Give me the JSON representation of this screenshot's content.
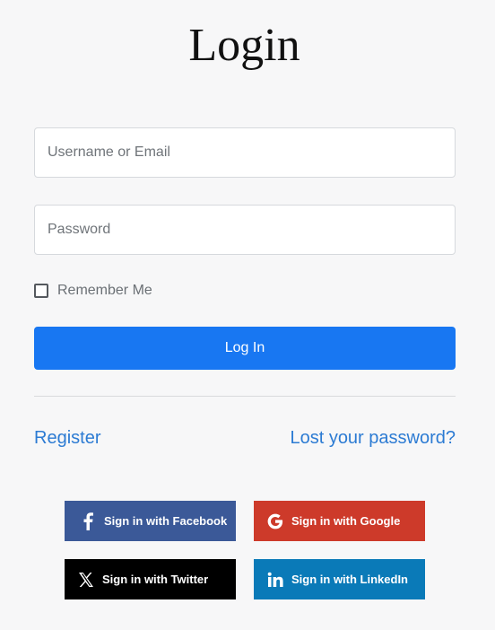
{
  "page": {
    "title": "Login"
  },
  "form": {
    "username_placeholder": "Username or Email",
    "username_value": "",
    "password_placeholder": "Password",
    "password_value": "",
    "remember_label": "Remember Me",
    "remember_checked": false,
    "submit_label": "Log In"
  },
  "links": {
    "register": "Register",
    "lost_password": "Lost your password?"
  },
  "social": {
    "facebook": {
      "label": "Sign in with Facebook",
      "icon": "facebook-icon",
      "color": "#3b5998"
    },
    "google": {
      "label": "Sign in with Google",
      "icon": "google-icon",
      "color": "#cd3a2a"
    },
    "twitter": {
      "label": "Sign in with Twitter",
      "icon": "x-twitter-icon",
      "color": "#000000"
    },
    "linkedin": {
      "label": "Sign in with LinkedIn",
      "icon": "linkedin-icon",
      "color": "#0a7ab8"
    }
  },
  "colors": {
    "primary": "#1877f2",
    "link": "#2c7bd3",
    "background": "#f7f7f8"
  }
}
